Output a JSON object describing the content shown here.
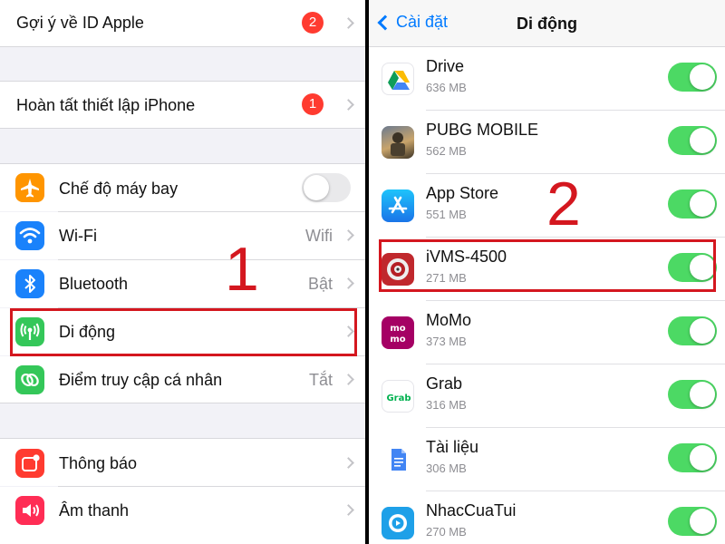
{
  "left": {
    "apple_id_suggestion": {
      "label": "Gợi ý về ID Apple",
      "badge": "2"
    },
    "finish_setup": {
      "label": "Hoàn tất thiết lập iPhone",
      "badge": "1"
    },
    "airplane": {
      "label": "Chế độ máy bay",
      "icon": "airplane-icon",
      "toggle_on": false
    },
    "wifi": {
      "label": "Wi-Fi",
      "value": "Wifi",
      "icon": "wifi-icon"
    },
    "bluetooth": {
      "label": "Bluetooth",
      "value": "Bật",
      "icon": "bluetooth-icon"
    },
    "cellular": {
      "label": "Di động",
      "icon": "cellular-antenna-icon"
    },
    "hotspot": {
      "label": "Điểm truy cập cá nhân",
      "value": "Tắt",
      "icon": "hotspot-link-icon"
    },
    "notifications": {
      "label": "Thông báo",
      "icon": "notifications-icon"
    },
    "sounds": {
      "label": "Âm thanh",
      "icon": "speaker-icon"
    },
    "step_number": "1"
  },
  "right": {
    "nav": {
      "back_label": "Cài đặt",
      "title": "Di động"
    },
    "apps": [
      {
        "name": "Drive",
        "size": "636 MB",
        "icon": "google-drive-icon",
        "enabled": true
      },
      {
        "name": "PUBG MOBILE",
        "size": "562 MB",
        "icon": "pubg-icon",
        "enabled": true
      },
      {
        "name": "App Store",
        "size": "551 MB",
        "icon": "app-store-icon",
        "enabled": true
      },
      {
        "name": "iVMS-4500",
        "size": "271 MB",
        "icon": "ivms-camera-icon",
        "enabled": true
      },
      {
        "name": "MoMo",
        "size": "373 MB",
        "icon": "momo-icon",
        "enabled": true
      },
      {
        "name": "Grab",
        "size": "316 MB",
        "icon": "grab-icon",
        "enabled": true
      },
      {
        "name": "Tài liệu",
        "size": "306 MB",
        "icon": "google-docs-icon",
        "enabled": true
      },
      {
        "name": "NhacCuaTui",
        "size": "270 MB",
        "icon": "nhaccuatui-icon",
        "enabled": true
      }
    ],
    "step_number": "2"
  },
  "colors": {
    "accent_blue": "#007aff",
    "toggle_green": "#4cd964",
    "badge_red": "#ff3b30",
    "highlight_red": "#d4171f"
  }
}
